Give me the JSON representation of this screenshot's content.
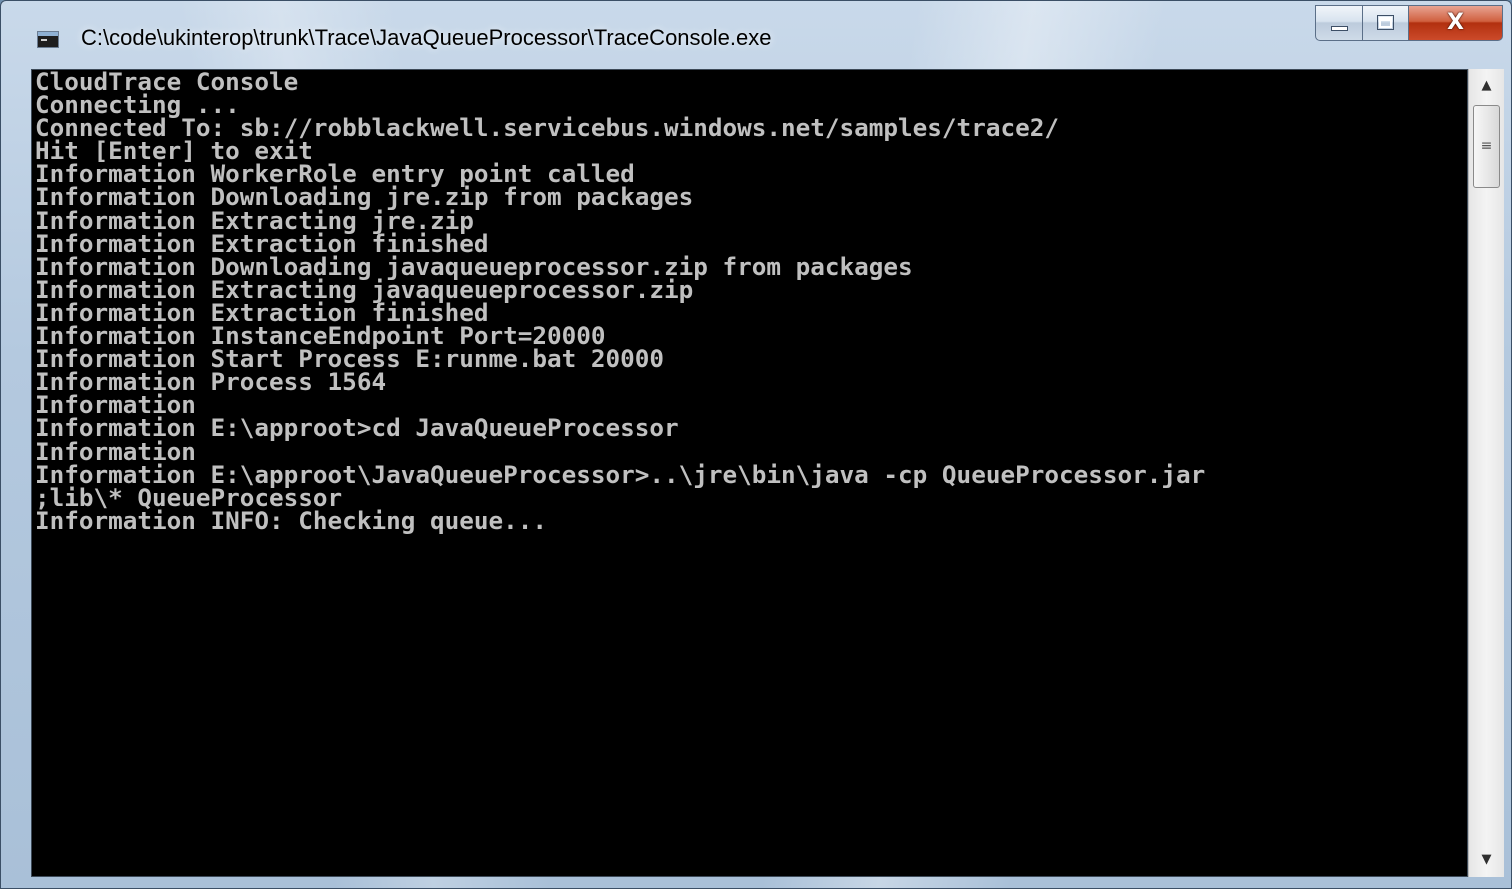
{
  "window": {
    "title": "C:\\code\\ukinterop\\trunk\\Trace\\JavaQueueProcessor\\TraceConsole.exe",
    "icon": "console-app-icon",
    "controls": {
      "minimize_icon": "minimize-icon",
      "maximize_icon": "maximize-icon",
      "close_glyph": "X"
    }
  },
  "console": {
    "background": "#000000",
    "foreground": "#c0c0c0",
    "lines": [
      "CloudTrace Console",
      "Connecting ...",
      "Connected To: sb://robblackwell.servicebus.windows.net/samples/trace2/",
      "Hit [Enter] to exit",
      "Information WorkerRole entry point called",
      "Information Downloading jre.zip from packages",
      "Information Extracting jre.zip",
      "Information Extraction finished",
      "Information Downloading javaqueueprocessor.zip from packages",
      "Information Extracting javaqueueprocessor.zip",
      "Information Extraction finished",
      "Information InstanceEndpoint Port=20000",
      "Information Start Process E:runme.bat 20000",
      "Information Process 1564",
      "Information",
      "Information E:\\approot>cd JavaQueueProcessor",
      "Information",
      "Information E:\\approot\\JavaQueueProcessor>..\\jre\\bin\\java -cp QueueProcessor.jar",
      ";lib\\* QueueProcessor",
      "Information INFO: Checking queue..."
    ]
  },
  "scrollbar": {
    "up_arrow": "▲",
    "down_arrow": "▼",
    "grip": "≡"
  }
}
